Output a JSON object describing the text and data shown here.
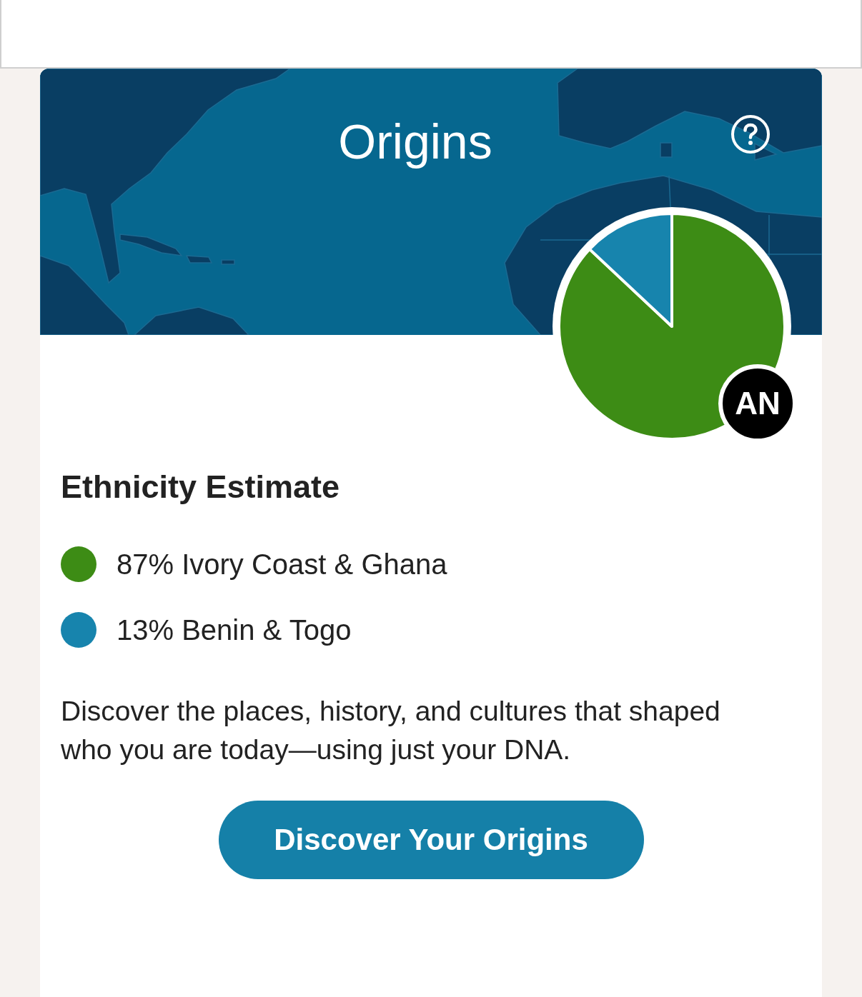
{
  "header": {
    "title": "Origins"
  },
  "avatar": {
    "initials": "AN"
  },
  "ethnicity": {
    "heading": "Ethnicity Estimate",
    "regions": [
      {
        "percent": "87%",
        "color": "#3d8c15"
      },
      {
        "percent": "13%",
        "color": "#1784ad"
      }
    ],
    "chart_data": {
      "type": "pie",
      "categories": [
        "Ivory Coast & Ghana",
        "Benin & Togo"
      ],
      "values": [
        87,
        13
      ]
    }
  },
  "description": "Discover the places, history, and cultures that shaped who you are today—using just your DNA.",
  "button": {
    "label": "Discover Your Origins"
  }
}
